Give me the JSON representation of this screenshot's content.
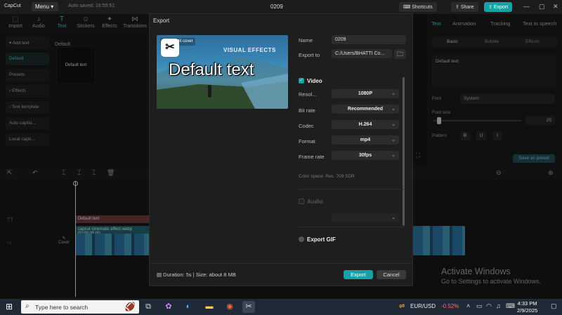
{
  "titlebar": {
    "app_name": "CapCut",
    "menu_label": "Menu",
    "autosave": "Auto saved: 16:55:51",
    "project_name": "0209",
    "shortcuts_label": "Shortcuts",
    "share_label": "Share",
    "export_label": "Export"
  },
  "media_tabs": [
    "Import",
    "Audio",
    "Text",
    "Stickers",
    "Effects",
    "Transitions"
  ],
  "left_nav": [
    "Add text",
    "Default",
    "Presets",
    "Effects",
    "Text template",
    "Auto captio...",
    "Local capti..."
  ],
  "left_panel": {
    "section_label": "Default",
    "thumb_label": "Default text"
  },
  "right_panel": {
    "tabs": [
      "Text",
      "Animation",
      "Tracking",
      "Text to speech"
    ],
    "subtabs": [
      "Basic",
      "Bubble",
      "Effects"
    ],
    "text_value": "Default text",
    "font_label": "Font",
    "font_value": "System",
    "font_size_label": "Font size",
    "font_size_value": "25",
    "pattern_label": "Pattern",
    "save_preset": "Save as preset"
  },
  "timeline": {
    "text_clip": "Default text",
    "video_clip": "capcut cinematic effect.webp  00:00:05:00",
    "cover_label": "Cover"
  },
  "export_dialog": {
    "title": "Export",
    "cover_badge": "Edit cover",
    "preview_heading": "VISUAL EFFECTS",
    "preview_text": "Default text",
    "name_label": "Name",
    "name_value": "0209",
    "export_to_label": "Export to",
    "export_to_value": "C:/Users/BHATTI Co...",
    "video_section": "Video",
    "resolution_label": "Resol...",
    "resolution_value": "1080P",
    "bitrate_label": "Bit rate",
    "bitrate_value": "Recommended",
    "codec_label": "Codec",
    "codec_value": "H.264",
    "format_label": "Format",
    "format_value": "mp4",
    "framerate_label": "Frame rate",
    "framerate_value": "30fps",
    "colorspace": "Color space: Rec. 709 SDR",
    "audio_section": "Audio",
    "gif_section": "Export GIF",
    "footer_info": "Duration: 5s | Size: about 8 MB",
    "export_button": "Export",
    "cancel_button": "Cancel"
  },
  "activate_windows": {
    "line1": "Activate Windows",
    "line2": "Go to Settings to activate Windows."
  },
  "taskbar": {
    "search_placeholder": "Type here to search",
    "ticker_label": "EUR/USD",
    "ticker_value": "-0.52%",
    "time": "4:33 PM",
    "date": "2/9/2025"
  }
}
